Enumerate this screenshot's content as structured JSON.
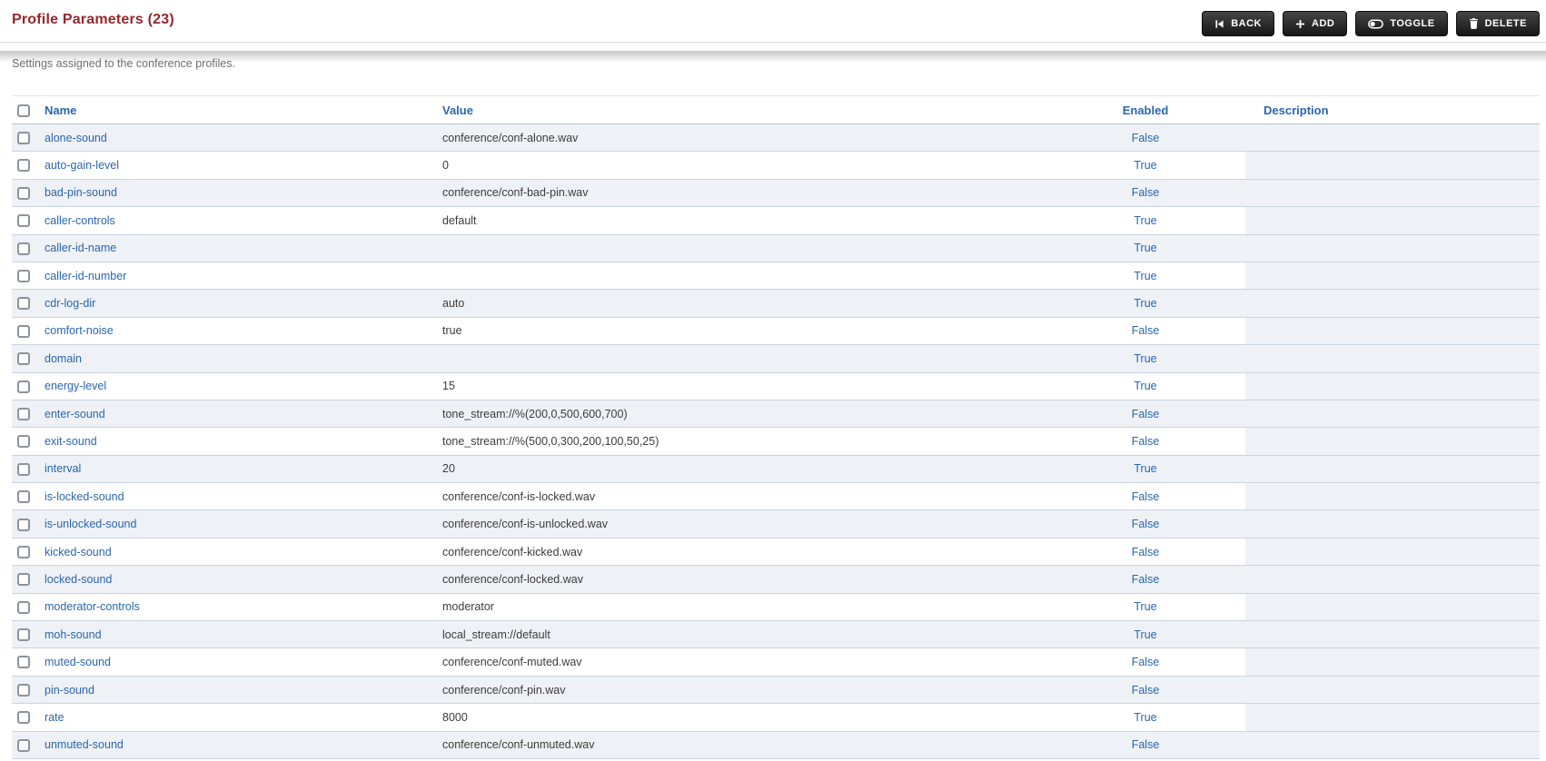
{
  "header": {
    "title": "Profile Parameters (23)",
    "buttons": {
      "back": "BACK",
      "add": "ADD",
      "toggle": "TOGGLE",
      "delete": "DELETE"
    }
  },
  "subtitle": "Settings assigned to the conference profiles.",
  "colors": {
    "title_red": "#94282d",
    "link_blue": "#2b66ad",
    "row_stripe": "#eef1f5",
    "row_border": "#c9d4e1",
    "button_dark": "#161616"
  },
  "table": {
    "columns": {
      "name": "Name",
      "value": "Value",
      "enabled": "Enabled",
      "description": "Description"
    },
    "rows": [
      {
        "name": "alone-sound",
        "value": "conference/conf-alone.wav",
        "enabled": "False",
        "description": ""
      },
      {
        "name": "auto-gain-level",
        "value": "0",
        "enabled": "True",
        "description": ""
      },
      {
        "name": "bad-pin-sound",
        "value": "conference/conf-bad-pin.wav",
        "enabled": "False",
        "description": ""
      },
      {
        "name": "caller-controls",
        "value": "default",
        "enabled": "True",
        "description": ""
      },
      {
        "name": "caller-id-name",
        "value": "",
        "enabled": "True",
        "description": ""
      },
      {
        "name": "caller-id-number",
        "value": "",
        "enabled": "True",
        "description": ""
      },
      {
        "name": "cdr-log-dir",
        "value": "auto",
        "enabled": "True",
        "description": ""
      },
      {
        "name": "comfort-noise",
        "value": "true",
        "enabled": "False",
        "description": ""
      },
      {
        "name": "domain",
        "value": "",
        "enabled": "True",
        "description": ""
      },
      {
        "name": "energy-level",
        "value": "15",
        "enabled": "True",
        "description": ""
      },
      {
        "name": "enter-sound",
        "value": "tone_stream://%(200,0,500,600,700)",
        "enabled": "False",
        "description": ""
      },
      {
        "name": "exit-sound",
        "value": "tone_stream://%(500,0,300,200,100,50,25)",
        "enabled": "False",
        "description": ""
      },
      {
        "name": "interval",
        "value": "20",
        "enabled": "True",
        "description": ""
      },
      {
        "name": "is-locked-sound",
        "value": "conference/conf-is-locked.wav",
        "enabled": "False",
        "description": ""
      },
      {
        "name": "is-unlocked-sound",
        "value": "conference/conf-is-unlocked.wav",
        "enabled": "False",
        "description": ""
      },
      {
        "name": "kicked-sound",
        "value": "conference/conf-kicked.wav",
        "enabled": "False",
        "description": ""
      },
      {
        "name": "locked-sound",
        "value": "conference/conf-locked.wav",
        "enabled": "False",
        "description": ""
      },
      {
        "name": "moderator-controls",
        "value": "moderator",
        "enabled": "True",
        "description": ""
      },
      {
        "name": "moh-sound",
        "value": "local_stream://default",
        "enabled": "True",
        "description": ""
      },
      {
        "name": "muted-sound",
        "value": "conference/conf-muted.wav",
        "enabled": "False",
        "description": ""
      },
      {
        "name": "pin-sound",
        "value": "conference/conf-pin.wav",
        "enabled": "False",
        "description": ""
      },
      {
        "name": "rate",
        "value": "8000",
        "enabled": "True",
        "description": ""
      },
      {
        "name": "unmuted-sound",
        "value": "conference/conf-unmuted.wav",
        "enabled": "False",
        "description": ""
      }
    ]
  }
}
